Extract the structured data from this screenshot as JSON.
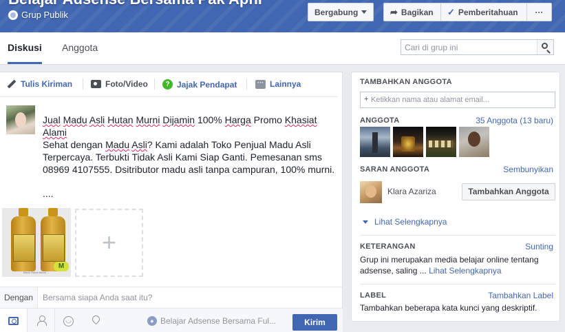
{
  "header": {
    "group_name": "Belajar Adsense Bersama Pak Apni",
    "privacy": "Grup Publik",
    "join_label": "Bergabung",
    "share_label": "Bagikan",
    "notifications_label": "Pemberitahuan",
    "more_label": "···",
    "brand_color": "#4267b2"
  },
  "tabs": [
    {
      "label": "Diskusi",
      "active": true
    },
    {
      "label": "Anggota",
      "active": false
    }
  ],
  "search": {
    "placeholder": "Cari di grup ini",
    "icon": "search-icon"
  },
  "composer": {
    "tabs": [
      {
        "label": "Tulis Kiriman",
        "icon": "pencil-icon"
      },
      {
        "label": "Foto/Video",
        "icon": "camera-icon"
      },
      {
        "label": "Jajak Pendapat",
        "icon": "poll-icon"
      },
      {
        "label": "Lainnya",
        "icon": "more-icon"
      }
    ],
    "post": {
      "line1_a": "Jual",
      "line1_b": "Madu",
      "line1_c": "Asli",
      "line1_d": "Hutan",
      "line1_e": "Murni",
      "line1_f": "Dijamin",
      "line1_g": "100%",
      "line1_h": "Harga",
      "line1_i": "Promo",
      "line1_j": "Khasiat",
      "line1_k": "Alami",
      "line2_a": "Sehat dengan",
      "line2_b": "Madu",
      "line2_c": "Asli",
      "line2_rest": "? Kami adalah Toko Penjual Madu Asli Terpercaya. Terbukti Tidak Asli Kami Siap Ganti. Pemesanan sms 08969 4107555. Dsitributor madu asli tanpa campuran, 100% murni.",
      "ellipsis": "....",
      "photo_mark": "M",
      "photo_caption": "Madu Hutan Murni"
    },
    "add_photo": "+",
    "with_label": "Dengan",
    "with_placeholder": "Bersama siapa Anda saat itu?",
    "audience": "Belajar Adsense Bersama Ful...",
    "post_button": "Kirim"
  },
  "sidebar": {
    "add_members_title": "TAMBAHKAN ANGGOTA",
    "add_members_placeholder": "Ketikkan nama atau alamat email...",
    "add_members_plus": "+",
    "members_title": "ANGGOTA",
    "members_count": "35 Anggota (13 baru)",
    "suggest_title": "SARAN ANGGOTA",
    "suggest_hide": "Sembunyikan",
    "suggest_name": "Klara Azariza",
    "suggest_button": "Tambahkan Anggota",
    "see_more": "Lihat Selengkapnya",
    "about_title": "KETERANGAN",
    "about_link": "Sunting",
    "about_text": "Grup ini merupakan media belajar online tentang adsense, saling ...",
    "about_more": "Lihat Selengkapnya",
    "label_title": "LABEL",
    "label_link": "Tambahkan Label",
    "label_text": "Tambahkan beberapa kata kunci yang deskriptif."
  }
}
